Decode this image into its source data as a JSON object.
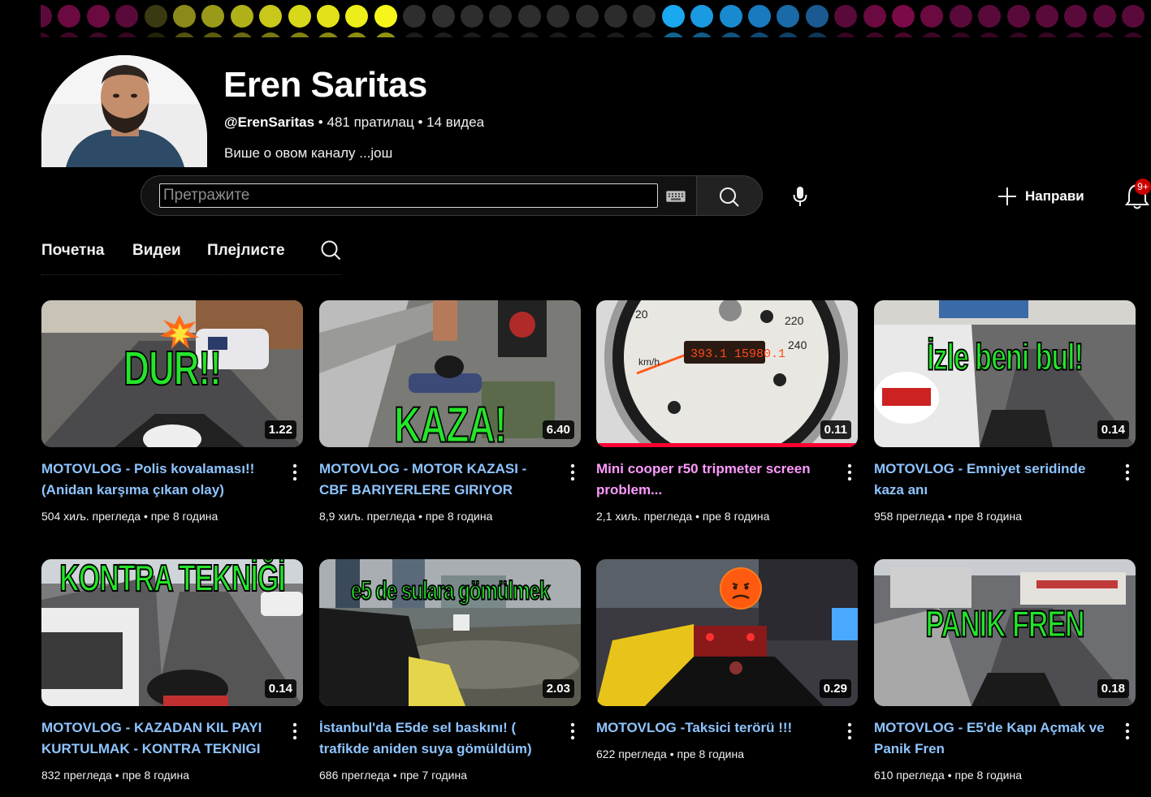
{
  "channel": {
    "name": "Eren Saritas",
    "handle": "@ErenSaritas",
    "subscribers": "481 пратилац",
    "video_count": "14 видеа",
    "separator": " • ",
    "about": "Више о овом каналу ...још"
  },
  "search": {
    "placeholder": "Претражите"
  },
  "header": {
    "create_label": "Направи",
    "notification_count": "9+"
  },
  "tabs": [
    {
      "label": "Почетна"
    },
    {
      "label": "Видеи"
    },
    {
      "label": "Плејлисте"
    }
  ],
  "colors": {
    "background": "#000000",
    "title_link": "#8ec4ff",
    "title_visited": "#ff9aff",
    "thumb_text": "#24e52a",
    "progress": "#ff0033",
    "badge": "#cc0000"
  },
  "videos": [
    {
      "title": "MOTOVLOG - Polis kovalaması!! (Anidan karşıma çıkan olay)",
      "views": "504 хиљ. прегледа",
      "age": "пре 8 година",
      "duration": "1.22",
      "thumb_text": "DUR!!",
      "visited": false
    },
    {
      "title": "MOTOVLOG - MOTOR KAZASI - CBF BARIYERLERE GIRIYOR",
      "views": "8,9 хиљ. прегледа",
      "age": "пре 8 година",
      "duration": "6.40",
      "thumb_text": "KAZA!",
      "visited": false
    },
    {
      "title": "Mini cooper r50 tripmeter screen problem...",
      "views": "2,1 хиљ. прегледа",
      "age": "пре 8 година",
      "duration": "0.11",
      "thumb_text": "",
      "visited": true,
      "watched_fraction": 1.0
    },
    {
      "title": "MOTOVLOG - Emniyet seridinde kaza anı",
      "views": "958 прегледа",
      "age": "пре 8 година",
      "duration": "0.14",
      "thumb_text": "İzle beni bul!",
      "visited": false
    },
    {
      "title": "MOTOVLOG - KAZADAN KIL PAYI KURTULMAK - KONTRA TEKNIGI",
      "views": "832 прегледа",
      "age": "пре 8 година",
      "duration": "0.14",
      "thumb_text": "KONTRA TEKNİĞİ",
      "visited": false
    },
    {
      "title": "İstanbul'da E5de sel baskını! ( trafikde aniden suya gömüldüm)",
      "views": "686 прегледа",
      "age": "пре 7 година",
      "duration": "2.03",
      "thumb_text": "e5 de sulara gömülmek",
      "visited": false
    },
    {
      "title": "MOTOVLOG -Taksici terörü !!!",
      "views": "622 прегледа",
      "age": "пре 8 година",
      "duration": "0.29",
      "thumb_text": "",
      "visited": false
    },
    {
      "title": "MOTOVLOG - E5'de Kapı Açmak ve Panik Fren",
      "views": "610 прегледа",
      "age": "пре 8 година",
      "duration": "0.18",
      "thumb_text": "PANIK FREN",
      "visited": false
    }
  ]
}
